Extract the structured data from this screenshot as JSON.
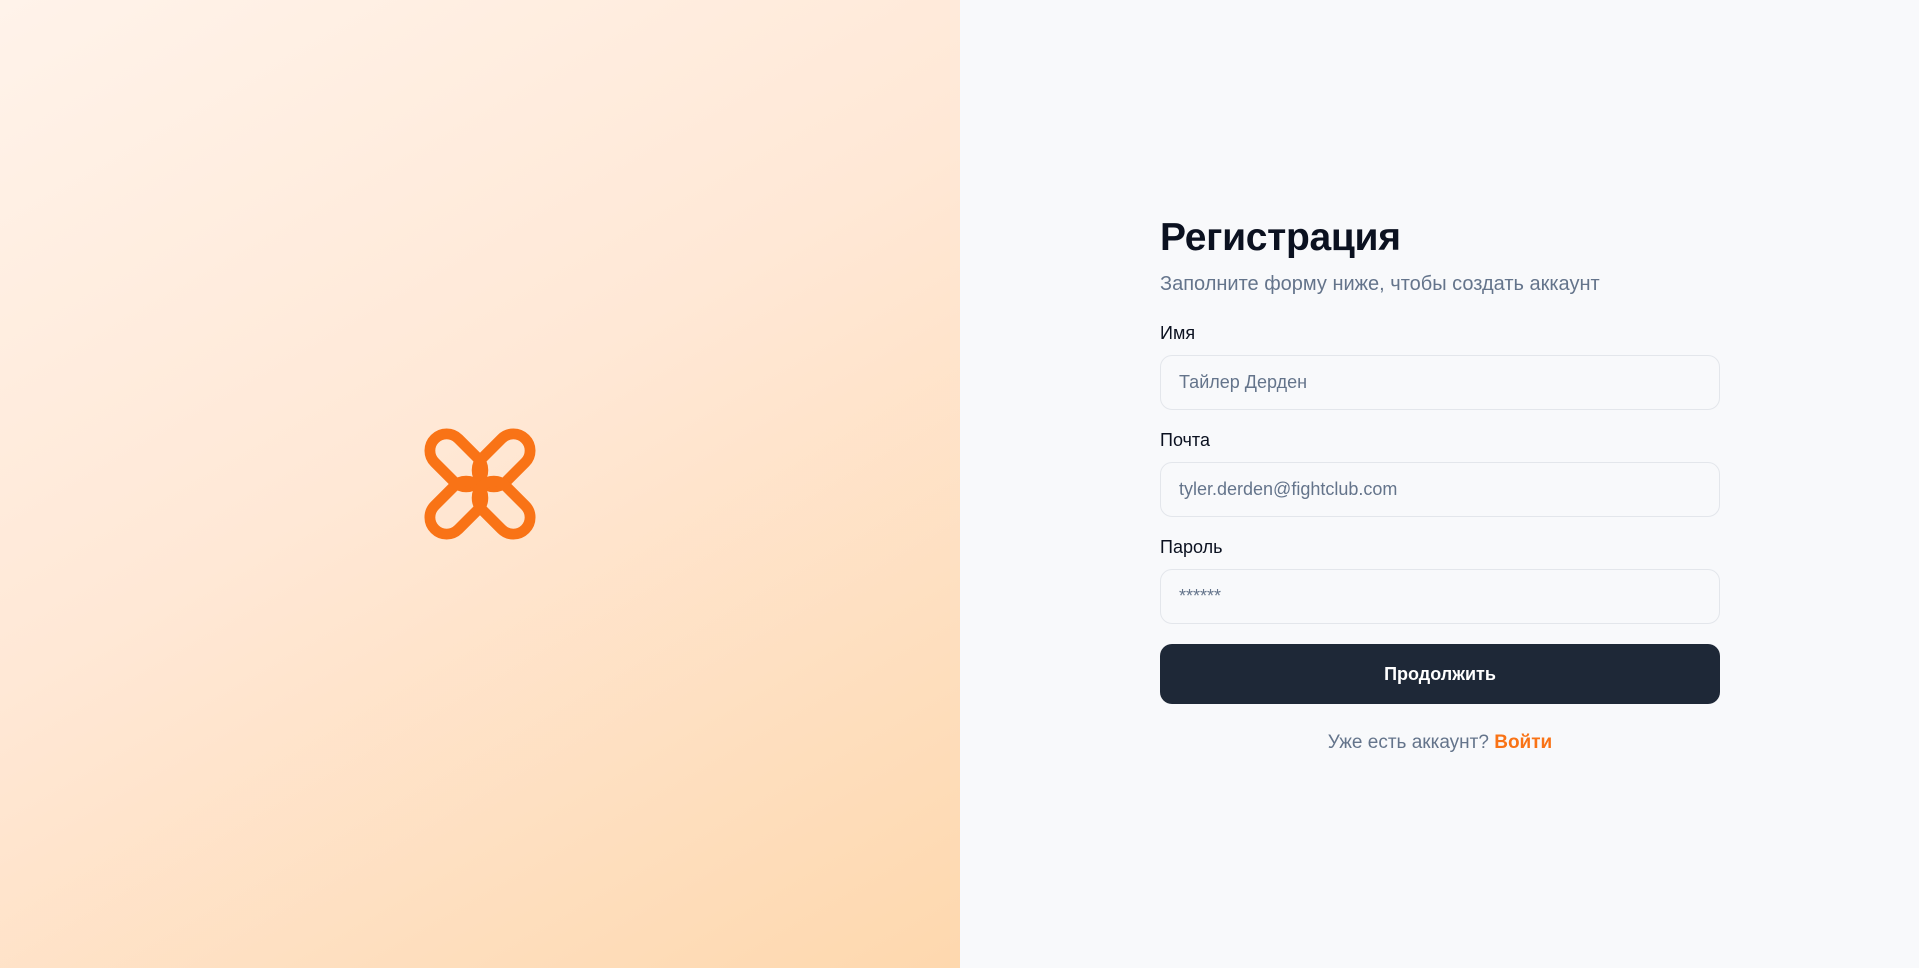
{
  "brand": {
    "logo_icon": "orange-quatrefoil-logo-icon",
    "accent_color": "#f97316"
  },
  "form": {
    "title": "Регистрация",
    "subtitle": "Заполните форму ниже, чтобы создать аккаунт",
    "fields": [
      {
        "label": "Имя",
        "placeholder": "Тайлер Дерден",
        "value": ""
      },
      {
        "label": "Почта",
        "placeholder": "tyler.derden@fightclub.com",
        "value": ""
      },
      {
        "label": "Пароль",
        "placeholder": "******",
        "value": ""
      }
    ],
    "submit_label": "Продолжить",
    "login_prompt": "Уже есть аккаунт?",
    "login_link": "Войти"
  },
  "colors": {
    "button_bg": "#1e2837",
    "panel_bg": "#f8f9fb",
    "text_primary": "#0b1120",
    "text_muted": "#64748b"
  }
}
